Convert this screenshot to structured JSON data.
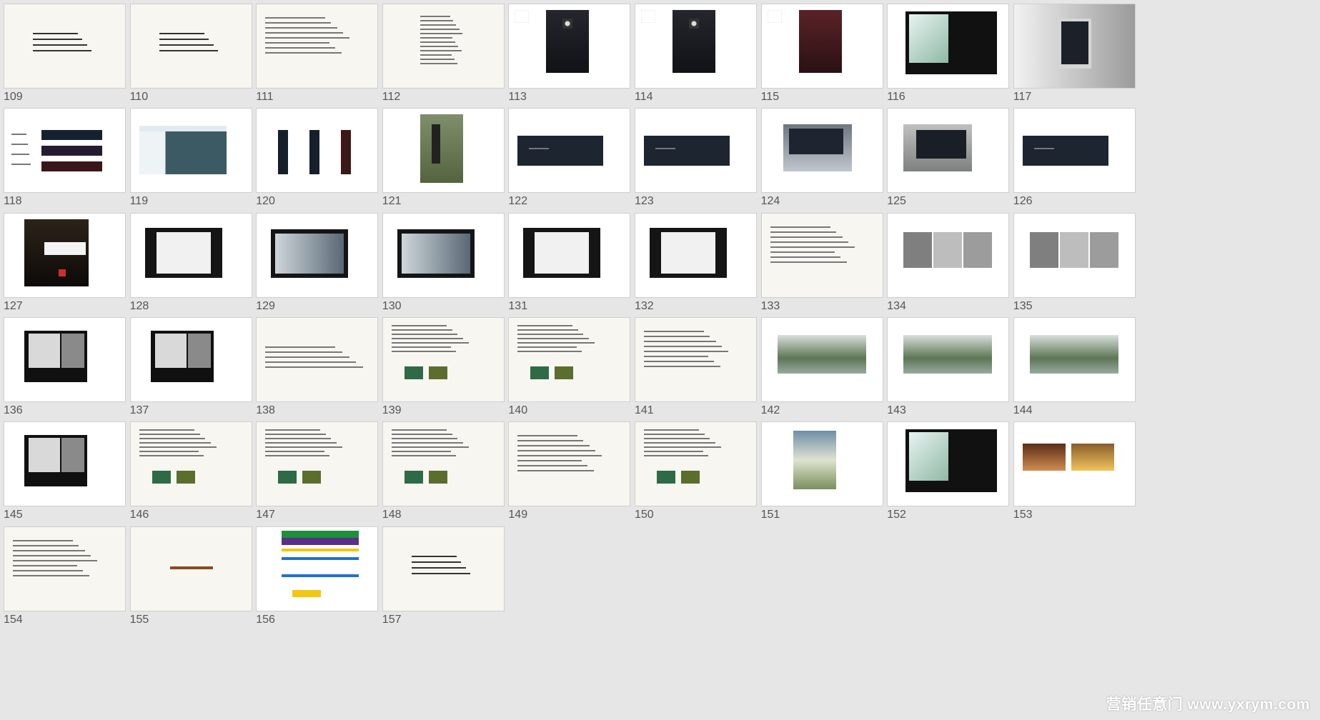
{
  "watermark": "营销任意门 www.yxrym.com",
  "slides": [
    {
      "n": "109",
      "kind": "text-center"
    },
    {
      "n": "110",
      "kind": "text-center"
    },
    {
      "n": "111",
      "kind": "text-left"
    },
    {
      "n": "112",
      "kind": "text-narrow"
    },
    {
      "n": "113",
      "kind": "dark-poster"
    },
    {
      "n": "114",
      "kind": "dark-poster"
    },
    {
      "n": "115",
      "kind": "red-poster"
    },
    {
      "n": "116",
      "kind": "brochure-dark"
    },
    {
      "n": "117",
      "kind": "lightbox"
    },
    {
      "n": "118",
      "kind": "banners-stack"
    },
    {
      "n": "119",
      "kind": "hoarding"
    },
    {
      "n": "120",
      "kind": "vertical-banners"
    },
    {
      "n": "121",
      "kind": "street-banner"
    },
    {
      "n": "122",
      "kind": "dark-banner"
    },
    {
      "n": "123",
      "kind": "dark-banner"
    },
    {
      "n": "124",
      "kind": "billboard"
    },
    {
      "n": "125",
      "kind": "subway-ad"
    },
    {
      "n": "126",
      "kind": "dark-banner"
    },
    {
      "n": "127",
      "kind": "night-building"
    },
    {
      "n": "128",
      "kind": "book-white"
    },
    {
      "n": "129",
      "kind": "book-photo"
    },
    {
      "n": "130",
      "kind": "book-photo"
    },
    {
      "n": "131",
      "kind": "book-white"
    },
    {
      "n": "132",
      "kind": "book-white"
    },
    {
      "n": "133",
      "kind": "text-left"
    },
    {
      "n": "134",
      "kind": "photo-strip"
    },
    {
      "n": "135",
      "kind": "photo-strip"
    },
    {
      "n": "136",
      "kind": "brochure-bw"
    },
    {
      "n": "137",
      "kind": "brochure-bw"
    },
    {
      "n": "138",
      "kind": "text-paragraph"
    },
    {
      "n": "139",
      "kind": "text-images"
    },
    {
      "n": "140",
      "kind": "text-images"
    },
    {
      "n": "141",
      "kind": "text-left"
    },
    {
      "n": "142",
      "kind": "landscape"
    },
    {
      "n": "143",
      "kind": "landscape"
    },
    {
      "n": "144",
      "kind": "landscape"
    },
    {
      "n": "145",
      "kind": "brochure-bw"
    },
    {
      "n": "146",
      "kind": "text-images"
    },
    {
      "n": "147",
      "kind": "text-images"
    },
    {
      "n": "148",
      "kind": "text-images"
    },
    {
      "n": "149",
      "kind": "text-left"
    },
    {
      "n": "150",
      "kind": "text-images"
    },
    {
      "n": "151",
      "kind": "golf-poster"
    },
    {
      "n": "152",
      "kind": "brochure-dark"
    },
    {
      "n": "153",
      "kind": "interior-photos"
    },
    {
      "n": "154",
      "kind": "text-left"
    },
    {
      "n": "155",
      "kind": "title-center"
    },
    {
      "n": "156",
      "kind": "gantt-table"
    },
    {
      "n": "157",
      "kind": "text-center"
    }
  ],
  "colors": {
    "background": "#e6e6e6",
    "slide_white": "#ffffff",
    "slide_cream": "#f7f6f1",
    "number": "#555555"
  }
}
